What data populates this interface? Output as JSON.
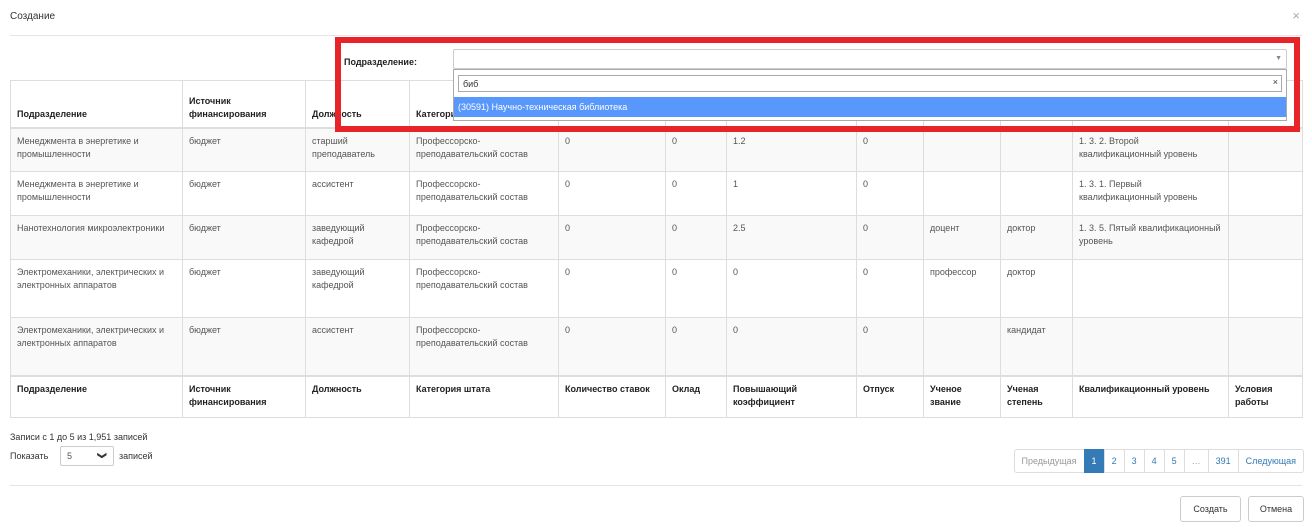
{
  "modal": {
    "title": "Создание",
    "close_symbol": "×"
  },
  "filter": {
    "label": "Подразделение:",
    "selected_value": "",
    "search_text": "биб",
    "clear_symbol": "×",
    "highlighted_option": "(30591) Научно-техническая библиотека"
  },
  "table": {
    "columns": [
      "Подразделение",
      "Источник финансирования",
      "Должность",
      "Категория штата",
      "Количество ставок",
      "Оклад",
      "Повышающий коэффициент",
      "Отпуск",
      "Ученое звание",
      "Ученая степень",
      "Квалификационный уровень",
      "Условия работы"
    ],
    "header_visible": [
      "Подразделение",
      "Источник финансирования",
      "Должность",
      "Категория"
    ],
    "rows": [
      [
        "Менеджмента в энергетике и промышленности",
        "бюджет",
        "старший преподаватель",
        "Профессорско-преподавательский состав",
        "0",
        "0",
        "1.2",
        "0",
        "",
        "",
        "1. 3. 2. Второй квалификационный уровень",
        ""
      ],
      [
        "Менеджмента в энергетике и промышленности",
        "бюджет",
        "ассистент",
        "Профессорско-преподавательский состав",
        "0",
        "0",
        "1",
        "0",
        "",
        "",
        "1. 3. 1. Первый квалификационный уровень",
        ""
      ],
      [
        "Нанотехнология микроэлектроники",
        "бюджет",
        "заведующий кафедрой",
        "Профессорско-преподавательский состав",
        "0",
        "0",
        "2.5",
        "0",
        "доцент",
        "доктор",
        "1. 3. 5. Пятый квалификационный уровень",
        ""
      ],
      [
        "Электромеханики, электрических и электронных аппаратов",
        "бюджет",
        "заведующий кафедрой",
        "Профессорско-преподавательский состав",
        "0",
        "0",
        "0",
        "0",
        "профессор",
        "доктор",
        "",
        ""
      ],
      [
        "Электромеханики, электрических и электронных аппаратов",
        "бюджет",
        "ассистент",
        "Профессорско-преподавательский состав",
        "0",
        "0",
        "0",
        "0",
        "",
        "кандидат",
        "",
        ""
      ]
    ]
  },
  "info_text": "Записи с 1 до 5 из 1,951 записей",
  "length": {
    "prefix": "Показать",
    "value": "5",
    "suffix": "записей",
    "arrow": "❯"
  },
  "pagination": {
    "prev": "Предыдущая",
    "pages": [
      "1",
      "2",
      "3",
      "4",
      "5"
    ],
    "ellipsis": "…",
    "last_page": "391",
    "next": "Следующая",
    "active": "1"
  },
  "buttons": {
    "create": "Создать",
    "cancel": "Отмена"
  },
  "colors": {
    "highlight": "#5897fb",
    "frame": "#e8242b",
    "active_page": "#337ab7"
  }
}
